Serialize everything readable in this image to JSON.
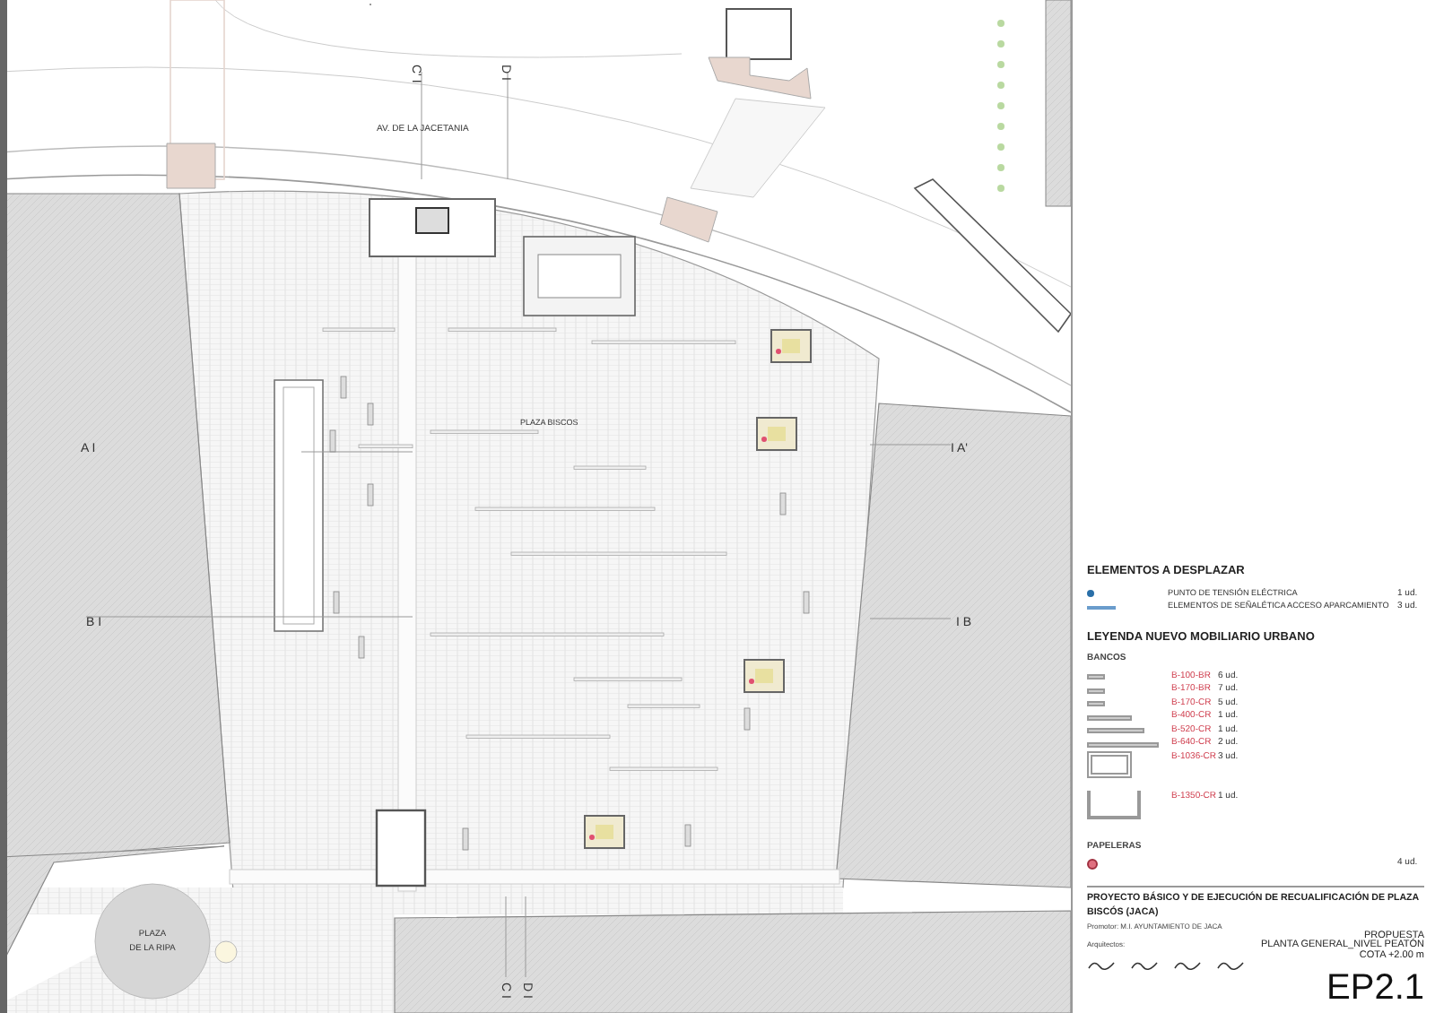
{
  "plan": {
    "labels": [
      {
        "kind": "street",
        "text": "AV. DE LA JACETANIA"
      },
      {
        "kind": "square",
        "text": "PLAZA BISCOS"
      },
      {
        "kind": "section",
        "text": "A I"
      },
      {
        "kind": "section",
        "text": "I A'"
      },
      {
        "kind": "section",
        "text": "B I"
      },
      {
        "kind": "section",
        "text": "I B"
      },
      {
        "kind": "section_v",
        "text": "C' I"
      },
      {
        "kind": "section_v",
        "text": "D I"
      },
      {
        "kind": "section_v",
        "text": "C I"
      },
      {
        "kind": "section_v",
        "text": "D I"
      },
      {
        "kind": "square2",
        "text": "PLAZA"
      },
      {
        "kind": "square2",
        "text": "DE LA RIPA"
      }
    ]
  },
  "legend": {
    "displaced": {
      "title": "ELEMENTOS A DESPLAZAR",
      "items": [
        {
          "kind": "dot",
          "label": "PUNTO DE TENSIÓN ELÉCTRICA",
          "qty": "1 ud."
        },
        {
          "kind": "dash",
          "label": "ELEMENTOS DE SEÑALÉTICA ACCESO APARCAMIENTO",
          "qty": "3 ud."
        }
      ]
    },
    "furniture": {
      "title": "LEYENDA NUEVO MOBILIARIO URBANO",
      "benches_title": "BANCOS",
      "benches": [
        {
          "kind": "short",
          "code": "B-100-BR",
          "qty": "6 ud."
        },
        {
          "kind": "short",
          "code": "B-170-BR",
          "qty": "7 ud."
        },
        {
          "kind": "short",
          "code": "B-170-CR",
          "qty": "5 ud."
        },
        {
          "kind": "medium",
          "code": "B-400-CR",
          "qty": "1 ud."
        },
        {
          "kind": "long",
          "code": "B-520-CR",
          "qty": "1 ud."
        },
        {
          "kind": "longer",
          "code": "B-640-CR",
          "qty": "2 ud."
        },
        {
          "kind": "frame",
          "code": "B-1036-CR",
          "qty": "3 ud."
        },
        {
          "kind": "u",
          "code": "B-1350-CR",
          "qty": "1 ud."
        }
      ],
      "bins_title": "PAPELERAS",
      "bins": [
        {
          "qty": "4 ud."
        }
      ]
    }
  },
  "title_block": {
    "project": "PROYECTO BÁSICO Y DE EJECUCIÓN DE RECUALIFICACIÓN DE PLAZA BISCÓS (JACA)",
    "promoter": "Promotor: M.I. AYUNTAMIENTO DE JACA",
    "architects": "Arquitectos:",
    "phase": "PROPUESTA",
    "sheet_title": "PLANTA GENERAL_NIVEL PEATÓN",
    "level": "COTA +2.00 m",
    "sheet": "EP2.1"
  }
}
